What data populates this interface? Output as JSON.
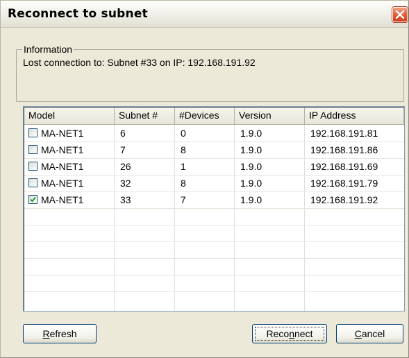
{
  "window": {
    "title": "Reconnect to subnet",
    "close_icon": "close-icon"
  },
  "information": {
    "legend": "Information",
    "message": "Lost connection to:  Subnet #33 on IP: 192.168.191.92"
  },
  "table": {
    "columns": [
      "Model",
      "Subnet #",
      "#Devices",
      "Version",
      "IP Address"
    ],
    "rows": [
      {
        "checked": false,
        "model": "MA-NET1",
        "subnet": "6",
        "devices": "0",
        "version": "1.9.0",
        "ip": "192.168.191.81"
      },
      {
        "checked": false,
        "model": "MA-NET1",
        "subnet": "7",
        "devices": "8",
        "version": "1.9.0",
        "ip": "192.168.191.86"
      },
      {
        "checked": false,
        "model": "MA-NET1",
        "subnet": "26",
        "devices": "1",
        "version": "1.9.0",
        "ip": "192.168.191.69"
      },
      {
        "checked": false,
        "model": "MA-NET1",
        "subnet": "32",
        "devices": "8",
        "version": "1.9.0",
        "ip": "192.168.191.79"
      },
      {
        "checked": true,
        "model": "MA-NET1",
        "subnet": "33",
        "devices": "7",
        "version": "1.9.0",
        "ip": "192.168.191.92"
      }
    ]
  },
  "buttons": {
    "refresh": {
      "mnemonic": "R",
      "rest": "efresh"
    },
    "reconnect": {
      "before": "Reco",
      "mnemonic": "n",
      "after": "nect"
    },
    "cancel": {
      "mnemonic": "C",
      "rest": "ancel"
    }
  },
  "colors": {
    "dialog_bg": "#ece9d8",
    "close_button": "#e45a35",
    "button_border": "#003c74"
  }
}
